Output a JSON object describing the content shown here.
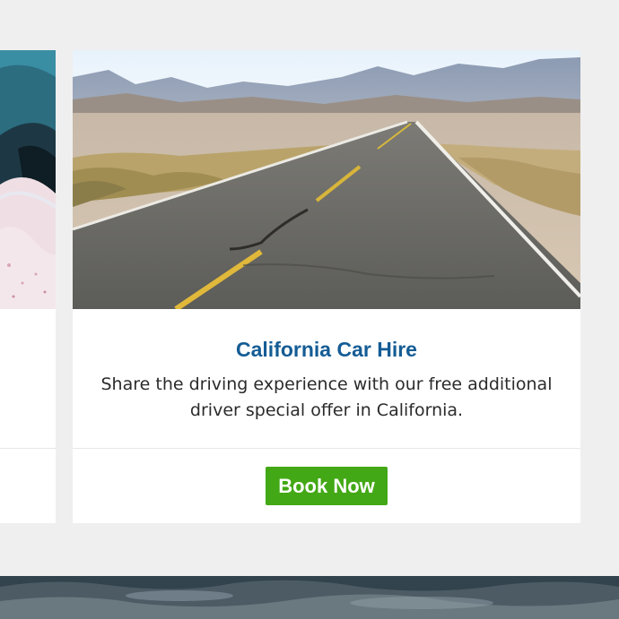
{
  "card": {
    "image_alt": "Desert highway stretching toward mountains",
    "title": "California Car Hire",
    "description": "Share the driving experience with our free additional driver special offer in California.",
    "button_label": "Book Now"
  },
  "colors": {
    "title": "#145c95",
    "button": "#43a815",
    "background": "#efefef"
  }
}
